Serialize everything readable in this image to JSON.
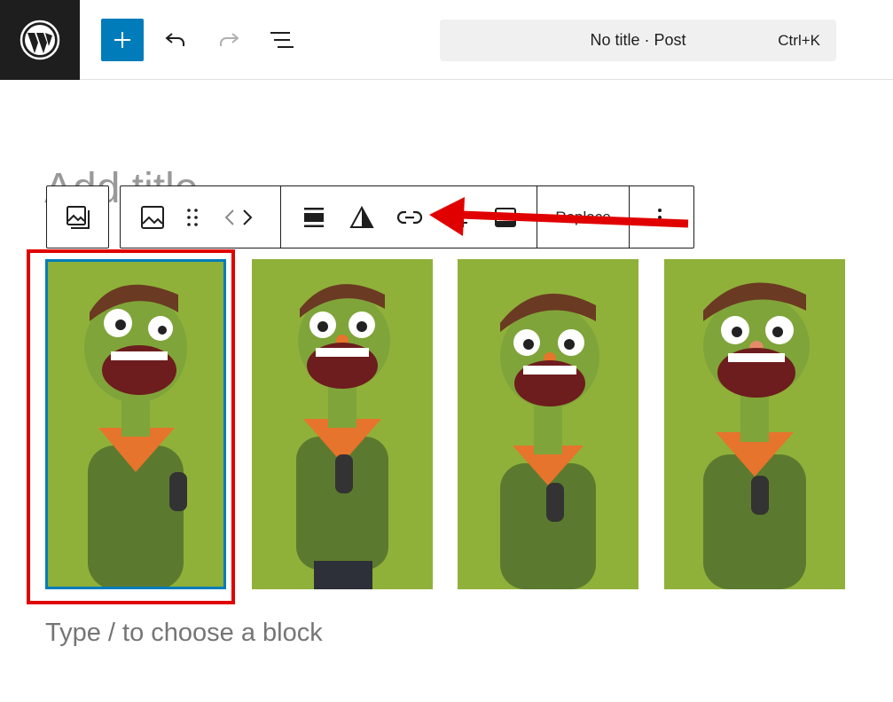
{
  "topbar": {
    "logo": "wordpress-logo",
    "add_button": "plus-icon",
    "undo": "undo-icon",
    "redo": "redo-icon",
    "document_overview": "list-view-icon",
    "command_bar": {
      "title": "No title · Post",
      "shortcut": "Ctrl+K"
    }
  },
  "editor": {
    "post_title_placeholder": "Add title",
    "block_placeholder": "Type / to choose a block"
  },
  "block_toolbar": {
    "parent": "gallery-icon",
    "items": [
      "image-icon",
      "drag-handle-icon",
      "move-arrows-icon",
      "align-icon",
      "duotone-icon",
      "link-icon",
      "crop-icon",
      "text-overlay-icon"
    ],
    "replace_label": "Replace",
    "more": "more-options-icon"
  },
  "gallery": {
    "images": [
      {
        "alt": "cartoon character with microphone",
        "selected": true
      },
      {
        "alt": "cartoon character with microphone",
        "selected": false
      },
      {
        "alt": "cartoon character with microphone",
        "selected": false
      },
      {
        "alt": "cartoon character with microphone",
        "selected": false
      }
    ]
  },
  "colors": {
    "accent": "#007cba",
    "highlight": "#e00000",
    "image_bg": "#8fb13a"
  }
}
